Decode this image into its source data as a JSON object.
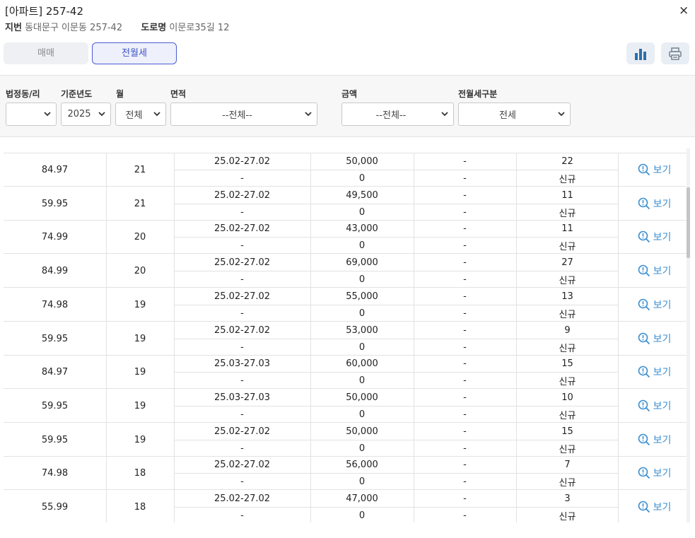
{
  "header": {
    "title": "[아파트] 257-42",
    "jibun_label": "지번",
    "jibun_value": "동대문구 이문동 257-42",
    "road_label": "도로명",
    "road_value": "이문로35길 12",
    "close_icon": "×"
  },
  "tabs": [
    {
      "label": "매매",
      "active": false
    },
    {
      "label": "전월세",
      "active": true
    }
  ],
  "toolbar": {
    "chart_icon": "bar-chart-icon",
    "print_icon": "printer-icon"
  },
  "filters": [
    {
      "label": "법정동/리",
      "value": ""
    },
    {
      "label": "기준년도",
      "value": "2025"
    },
    {
      "label": "월",
      "value": "전체"
    },
    {
      "label": "면적",
      "value": "--전체--"
    },
    {
      "label": "금액",
      "value": "--전체--"
    },
    {
      "label": "전월세구분",
      "value": "전세"
    }
  ],
  "view_label": "보기",
  "rows": [
    {
      "area": "84.97",
      "day": "21",
      "period": "25.02-27.02",
      "prev_period": "-",
      "deposit": "50,000",
      "prev_deposit": "0",
      "rent": "-",
      "prev_rent": "-",
      "floor": "22",
      "type": "신규"
    },
    {
      "area": "59.95",
      "day": "21",
      "period": "25.02-27.02",
      "prev_period": "-",
      "deposit": "49,500",
      "prev_deposit": "0",
      "rent": "-",
      "prev_rent": "-",
      "floor": "11",
      "type": "신규"
    },
    {
      "area": "74.99",
      "day": "20",
      "period": "25.02-27.02",
      "prev_period": "-",
      "deposit": "43,000",
      "prev_deposit": "0",
      "rent": "-",
      "prev_rent": "-",
      "floor": "11",
      "type": "신규"
    },
    {
      "area": "84.99",
      "day": "20",
      "period": "25.02-27.02",
      "prev_period": "-",
      "deposit": "69,000",
      "prev_deposit": "0",
      "rent": "-",
      "prev_rent": "-",
      "floor": "27",
      "type": "신규"
    },
    {
      "area": "74.98",
      "day": "19",
      "period": "25.02-27.02",
      "prev_period": "-",
      "deposit": "55,000",
      "prev_deposit": "0",
      "rent": "-",
      "prev_rent": "-",
      "floor": "13",
      "type": "신규"
    },
    {
      "area": "59.95",
      "day": "19",
      "period": "25.02-27.02",
      "prev_period": "-",
      "deposit": "53,000",
      "prev_deposit": "0",
      "rent": "-",
      "prev_rent": "-",
      "floor": "9",
      "type": "신규"
    },
    {
      "area": "84.97",
      "day": "19",
      "period": "25.03-27.03",
      "prev_period": "-",
      "deposit": "60,000",
      "prev_deposit": "0",
      "rent": "-",
      "prev_rent": "-",
      "floor": "15",
      "type": "신규"
    },
    {
      "area": "59.95",
      "day": "19",
      "period": "25.03-27.03",
      "prev_period": "-",
      "deposit": "50,000",
      "prev_deposit": "0",
      "rent": "-",
      "prev_rent": "-",
      "floor": "10",
      "type": "신규"
    },
    {
      "area": "59.95",
      "day": "19",
      "period": "25.02-27.02",
      "prev_period": "-",
      "deposit": "50,000",
      "prev_deposit": "0",
      "rent": "-",
      "prev_rent": "-",
      "floor": "15",
      "type": "신규"
    },
    {
      "area": "74.98",
      "day": "18",
      "period": "25.02-27.02",
      "prev_period": "-",
      "deposit": "56,000",
      "prev_deposit": "0",
      "rent": "-",
      "prev_rent": "-",
      "floor": "7",
      "type": "신규"
    },
    {
      "area": "55.99",
      "day": "18",
      "period": "25.02-27.02",
      "prev_period": "-",
      "deposit": "47,000",
      "prev_deposit": "0",
      "rent": "-",
      "prev_rent": "-",
      "floor": "3",
      "type": "신규"
    }
  ],
  "colors": {
    "accent": "#4a5cd1",
    "link": "#3d8fd1",
    "chart_icon": "#2f6fa8"
  }
}
